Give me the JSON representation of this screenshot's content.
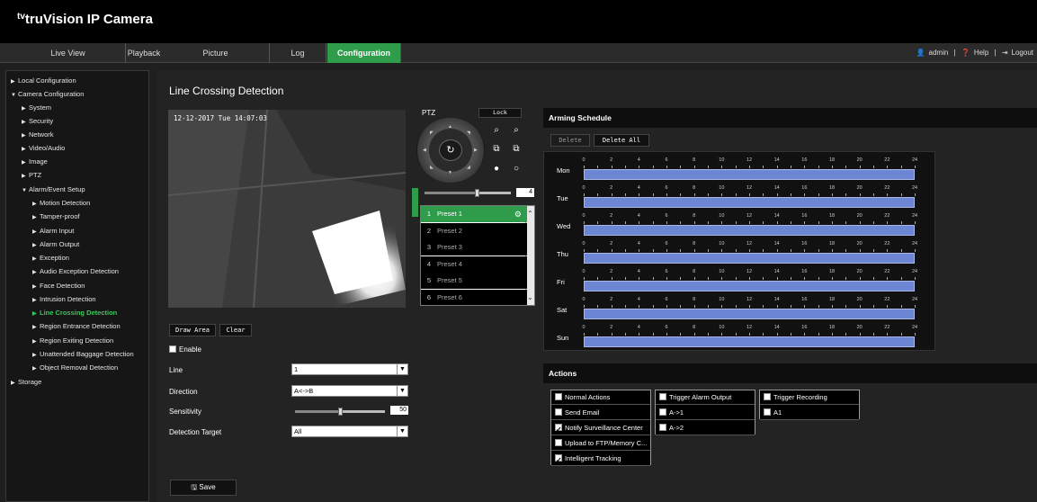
{
  "app": {
    "title": "truVision IP Camera",
    "logo_mark": "tv"
  },
  "nav": {
    "tabs": [
      "Live View",
      "Playback",
      "Picture",
      "Log",
      "Configuration"
    ],
    "active_tab": "Configuration",
    "user": "admin",
    "help": "Help",
    "logout": "Logout",
    "sep": "|"
  },
  "sidebar": {
    "items": [
      "Local Configuration",
      "Camera Configuration",
      "System",
      "Security",
      "Network",
      "Video/Audio",
      "Image",
      "PTZ",
      "Alarm/Event Setup",
      "Motion Detection",
      "Tamper-proof",
      "Alarm Input",
      "Alarm Output",
      "Exception",
      "Audio Exception Detection",
      "Face Detection",
      "Intrusion Detection",
      "Line Crossing Detection",
      "Region Entrance Detection",
      "Region Exiting Detection",
      "Unattended Baggage Detection",
      "Object Removal Detection",
      "Storage"
    ],
    "active_item": "Line Crossing Detection"
  },
  "page": {
    "title": "Line Crossing Detection"
  },
  "video": {
    "timestamp": "12-12-2017 Tue 14:07:03"
  },
  "buttons": {
    "draw_area": "Draw Area",
    "clear": "Clear",
    "save": "Save",
    "lock": "Lock",
    "delete": "Delete",
    "delete_all": "Delete All"
  },
  "form": {
    "enable_label": "Enable",
    "enable_checked": false,
    "line_label": "Line",
    "line_value": "1",
    "direction_label": "Direction",
    "direction_value": "A<->B",
    "sensitivity_label": "Sensitivity",
    "sensitivity_value": "50",
    "sensitivity_fraction": 0.5,
    "target_label": "Detection Target",
    "target_value": "All"
  },
  "ptz": {
    "label": "PTZ",
    "speed_value": "4",
    "speed_fraction": 0.6,
    "presets": [
      {
        "num": "1",
        "label": "Preset 1"
      },
      {
        "num": "2",
        "label": "Preset 2"
      },
      {
        "num": "3",
        "label": "Preset 3"
      },
      {
        "num": "4",
        "label": "Preset 4"
      },
      {
        "num": "5",
        "label": "Preset 5"
      },
      {
        "num": "6",
        "label": "Preset 6"
      }
    ],
    "selected_preset": "1"
  },
  "schedule": {
    "title": "Arming Schedule",
    "days": [
      "Mon",
      "Tue",
      "Wed",
      "Thu",
      "Fri",
      "Sat",
      "Sun"
    ],
    "hour_ticks": [
      "0",
      "2",
      "4",
      "6",
      "8",
      "10",
      "12",
      "14",
      "16",
      "18",
      "20",
      "22",
      "24"
    ],
    "armed_range_hours": [
      0,
      24
    ]
  },
  "actions": {
    "title": "Actions",
    "normal": {
      "header": "Normal Actions",
      "items": [
        {
          "label": "Send Email",
          "checked": false
        },
        {
          "label": "Notify Surveillance Center",
          "checked": true
        },
        {
          "label": "Upload to FTP/Memory C...",
          "checked": false
        },
        {
          "label": "Intelligent Tracking",
          "checked": true
        }
      ]
    },
    "alarm_output": {
      "header": "Trigger Alarm Output",
      "items": [
        {
          "label": "A->1",
          "checked": false
        },
        {
          "label": "A->2",
          "checked": false
        }
      ]
    },
    "recording": {
      "header": "Trigger Recording",
      "items": [
        {
          "label": "A1",
          "checked": false
        }
      ]
    }
  }
}
